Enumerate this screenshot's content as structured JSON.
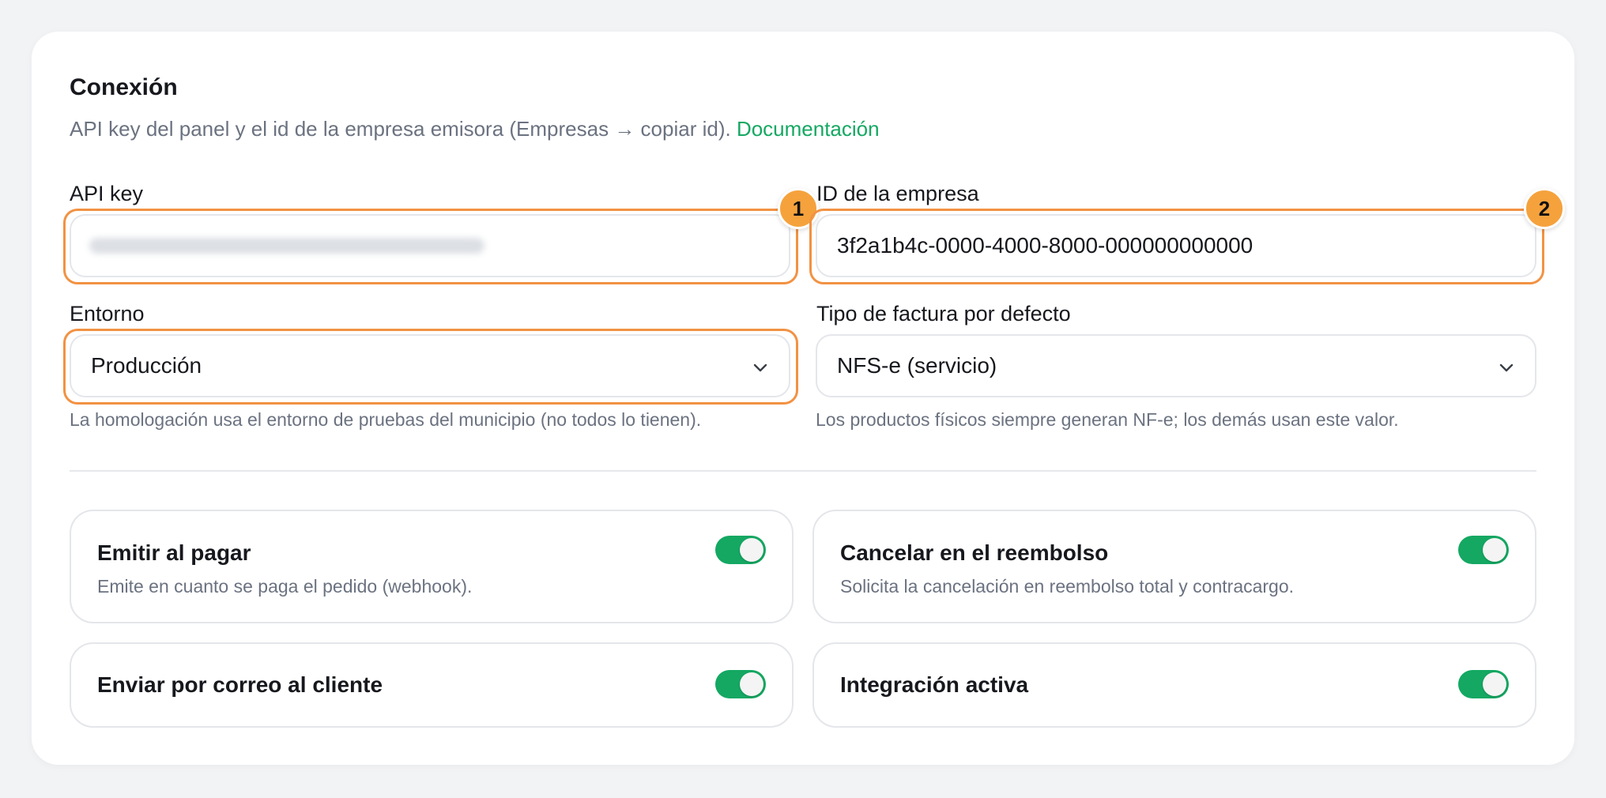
{
  "section": {
    "title": "Conexión",
    "subtitle": "API key del panel y el id de la empresa emisora (Empresas → copiar id).",
    "doc_link": "Documentación"
  },
  "fields": {
    "api_key": {
      "label": "API key"
    },
    "company_id": {
      "label": "ID de la empresa",
      "value": "3f2a1b4c-0000-4000-8000-000000000000"
    },
    "environment": {
      "label": "Entorno",
      "selected": "Producción",
      "hint": "La homologación usa el entorno de pruebas del municipio (no todos lo tienen)."
    },
    "invoice_type": {
      "label": "Tipo de factura por defecto",
      "selected": "NFS-e (servicio)",
      "hint": "Los productos físicos siempre generan NF-e; los demás usan este valor."
    }
  },
  "badges": {
    "one": "1",
    "two": "2"
  },
  "toggles": {
    "emit_on_pay": {
      "title": "Emitir al pagar",
      "desc": "Emite en cuanto se paga el pedido (webhook).",
      "on": true
    },
    "cancel_on_refund": {
      "title": "Cancelar en el reembolso",
      "desc": "Solicita la cancelación en reembolso total y contracargo.",
      "on": true
    },
    "email_customer": {
      "title": "Enviar por correo al cliente",
      "on": true
    },
    "active": {
      "title": "Integración activa",
      "on": true
    }
  },
  "colors": {
    "accent": "#14a862",
    "highlight": "#f29243",
    "badge": "#f5a23d"
  }
}
